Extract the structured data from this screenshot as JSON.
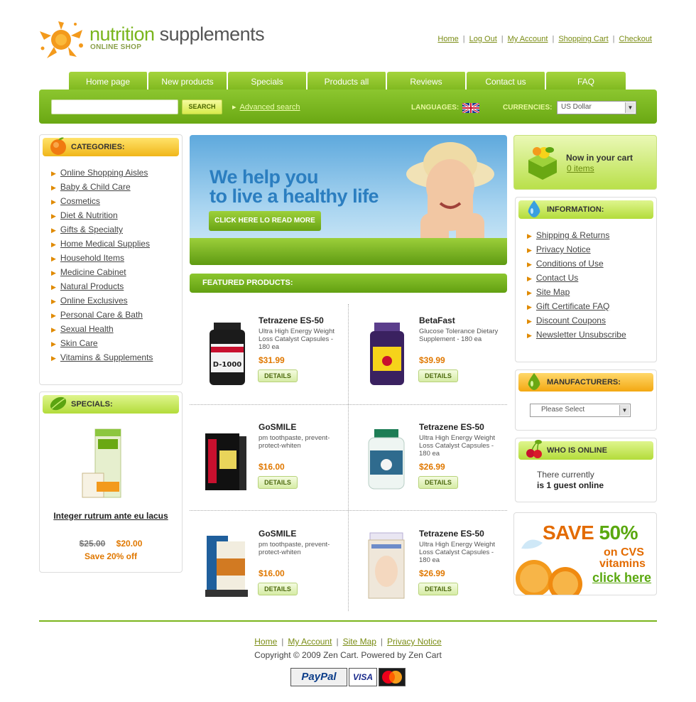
{
  "header": {
    "logo_word1": "nutrition",
    "logo_word2": "supplements",
    "logo_sub": "ONLINE SHOP",
    "top_links": [
      "Home",
      "Log Out",
      "My Account",
      "Shopping Cart",
      "Checkout"
    ]
  },
  "nav": {
    "tabs": [
      "Home page",
      "New products",
      "Specials",
      "Products all",
      "Reviews",
      "Contact us",
      "FAQ"
    ]
  },
  "search": {
    "button_label": "SEARCH",
    "advanced_label": "Advanced search",
    "languages_label": "LANGUAGES:",
    "currencies_label": "CURRENCIES:",
    "currency_value": "US Dollar"
  },
  "categories": {
    "title": "CATEGORIES:",
    "items": [
      "Online Shopping Aisles",
      "Baby & Child Care",
      "Cosmetics",
      "Diet & Nutrition",
      "Gifts & Specialty",
      "Home Medical Supplies",
      "Household Items",
      "Medicine Cabinet",
      "Natural Products",
      "Online Exclusives",
      "Personal Care & Bath",
      "Sexual Health",
      "Skin Care",
      "Vitamins & Supplements"
    ]
  },
  "specials": {
    "title": "SPECIALS:",
    "product_name": "Integer rutrum ante eu lacus",
    "old_price": "$25.00",
    "new_price": "$20.00",
    "save_text": "Save 20% off"
  },
  "hero": {
    "line1": "We help you",
    "line2": "to live a healthy life",
    "button": "CLICK HERE LO READ MORE"
  },
  "featured": {
    "title": "FEATURED PRODUCTS:",
    "details_label": "DETAILS",
    "products": [
      {
        "name": "Tetrazene ES-50",
        "desc": "Ultra High Energy Weight Loss Catalyst Capsules - 180 ea",
        "price": "$31.99"
      },
      {
        "name": "BetaFast",
        "desc": "Glucose Tolerance Dietary Supplement - 180 ea",
        "price": "$39.99"
      },
      {
        "name": "GoSMILE",
        "desc": "pm toothpaste, prevent-protect-whiten",
        "price": "$16.00"
      },
      {
        "name": "Tetrazene ES-50",
        "desc": "Ultra High Energy Weight Loss Catalyst Capsules - 180 ea",
        "price": "$26.99"
      },
      {
        "name": "GoSMILE",
        "desc": "pm toothpaste, prevent-protect-whiten",
        "price": "$16.00"
      },
      {
        "name": "Tetrazene ES-50",
        "desc": "Ultra High Energy Weight Loss Catalyst Capsules - 180 ea",
        "price": "$26.99"
      }
    ]
  },
  "cart": {
    "title": "Now in your cart",
    "items": "0 items"
  },
  "information": {
    "title": "INFORMATION:",
    "items": [
      "Shipping & Returns",
      "Privacy Notice",
      "Conditions of Use",
      "Contact Us",
      "Site Map",
      "Gift Certificate FAQ",
      "Discount Coupons",
      "Newsletter Unsubscribe"
    ]
  },
  "manufacturers": {
    "title": "MANUFACTURERS:",
    "placeholder": "Please Select"
  },
  "online": {
    "title": "WHO IS ONLINE",
    "line1": "There currently",
    "line2": "is 1 guest online"
  },
  "promo": {
    "save": "SAVE",
    "percent": "50%",
    "on_cvs": "on CVS",
    "vitamins": "vitamins",
    "click": "click here"
  },
  "footer": {
    "links": [
      "Home",
      "My Account",
      "Site Map",
      "Privacy Notice"
    ],
    "copyright": "Copyright © 2009 Zen Cart. Powered by Zen Cart",
    "paypal": "PayPal",
    "visa": "VISA",
    "mastercard": "MasterCard"
  },
  "colors": {
    "brand_green": "#7ab51d",
    "price_orange": "#e07800",
    "headline_blue": "#2b7ec0"
  }
}
